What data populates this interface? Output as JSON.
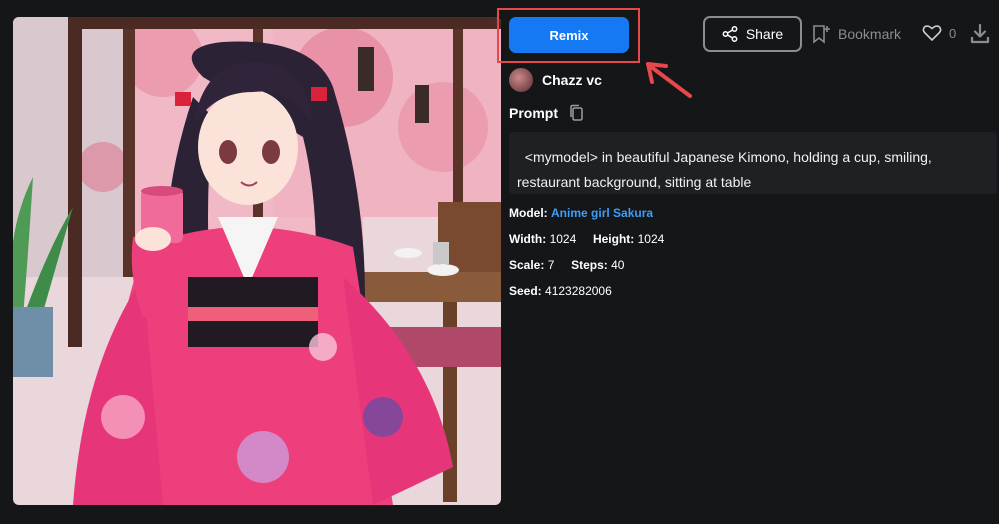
{
  "actions": {
    "remix_label": "Remix",
    "share_label": "Share",
    "bookmark_label": "Bookmark",
    "like_count": "0"
  },
  "user": {
    "name": "Chazz vc"
  },
  "prompt": {
    "label": "Prompt",
    "text": "<mymodel> in beautiful Japanese Kimono, holding a cup, smiling, restaurant background, sitting at table"
  },
  "details": {
    "model_label": "Model:",
    "model_value": "Anime girl Sakura",
    "width_label": "Width:",
    "width_value": "1024",
    "height_label": "Height:",
    "height_value": "1024",
    "scale_label": "Scale:",
    "scale_value": "7",
    "steps_label": "Steps:",
    "steps_value": "40",
    "seed_label": "Seed:",
    "seed_value": "4123282006"
  },
  "colors": {
    "background": "#141618",
    "accent": "#1479f2",
    "highlight": "#e8474c",
    "link": "#3f9df5"
  },
  "icons": [
    "share-icon",
    "bookmark-icon",
    "heart-icon",
    "download-icon",
    "copy-icon",
    "arrow-icon"
  ]
}
